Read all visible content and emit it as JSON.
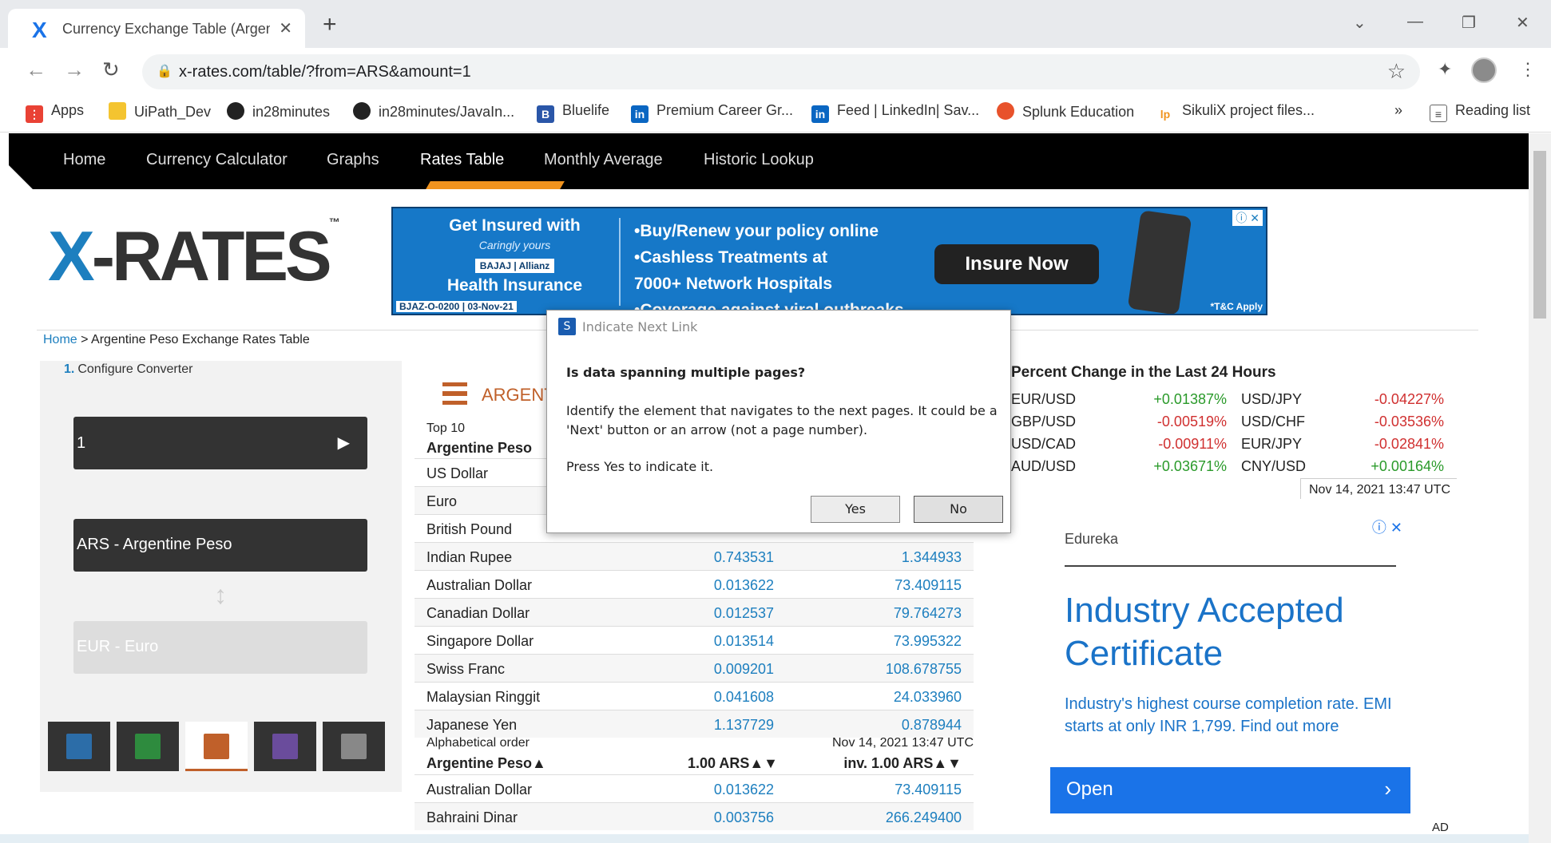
{
  "browser": {
    "tab_title": "Currency Exchange Table (Argent",
    "tab_favicon": "X",
    "url": "x-rates.com/table/?from=ARS&amount=1",
    "bookmarks": [
      {
        "label": "Apps",
        "icon": "apps-icon"
      },
      {
        "label": "UiPath_Dev",
        "icon": "folder-icon"
      },
      {
        "label": "in28minutes",
        "icon": "github-icon"
      },
      {
        "label": "in28minutes/JavaIn...",
        "icon": "github-icon"
      },
      {
        "label": "Bluelife",
        "icon": "bluelife-icon"
      },
      {
        "label": "Premium Career Gr...",
        "icon": "linkedin-icon"
      },
      {
        "label": "Feed | LinkedIn| Sav...",
        "icon": "linkedin-icon"
      },
      {
        "label": "Splunk Education",
        "icon": "splunk-icon"
      },
      {
        "label": "SikuliX project files...",
        "icon": "launchpad-icon"
      }
    ],
    "more_bookmarks": "»",
    "reading_list": "Reading list"
  },
  "site": {
    "nav": [
      "Home",
      "Currency Calculator",
      "Graphs",
      "Rates Table",
      "Monthly Average",
      "Historic Lookup"
    ],
    "active_nav": "Rates Table",
    "logo": {
      "x": "X",
      "rest": "-RATES",
      "tm": "™"
    },
    "banner": {
      "line1": "Get Insured with",
      "tagline": "Caringly yours",
      "brand": "BAJAJ | Allianz",
      "line2": "Health Insurance",
      "bullets": [
        "•Buy/Renew your policy online",
        "•Cashless Treatments at",
        " 7000+ Network Hospitals",
        "•Coverage against viral outbreaks"
      ],
      "cta": "Insure Now",
      "code": "BJAZ-O-0200 | 03-Nov-21",
      "tc": "*T&C Apply",
      "ad_info": "ⓘ ✕"
    },
    "breadcrumb": {
      "home": "Home",
      "current": "> Argentine Peso Exchange Rates Table"
    }
  },
  "converter": {
    "step_number": "1.",
    "step_label": "Configure Converter",
    "amount": "1",
    "from": "ARS - Argentine Peso",
    "swap": "↕",
    "to": "EUR - Euro"
  },
  "rates": {
    "heading": "ARGENT",
    "top10": "Top 10",
    "base": "Argentine Peso",
    "rows": [
      {
        "name": "US Dollar",
        "v1": "",
        "v2": ""
      },
      {
        "name": "Euro",
        "v1": "",
        "v2": ""
      },
      {
        "name": "British Pound",
        "v1": "",
        "v2": ""
      },
      {
        "name": "Indian Rupee",
        "v1": "0.743531",
        "v2": "1.344933"
      },
      {
        "name": "Australian Dollar",
        "v1": "0.013622",
        "v2": "73.409115"
      },
      {
        "name": "Canadian Dollar",
        "v1": "0.012537",
        "v2": "79.764273"
      },
      {
        "name": "Singapore Dollar",
        "v1": "0.013514",
        "v2": "73.995322"
      },
      {
        "name": "Swiss Franc",
        "v1": "0.009201",
        "v2": "108.678755"
      },
      {
        "name": "Malaysian Ringgit",
        "v1": "0.041608",
        "v2": "24.033960"
      },
      {
        "name": "Japanese Yen",
        "v1": "1.137729",
        "v2": "0.878944"
      }
    ],
    "alpha_label": "Alphabetical order",
    "alpha_date": "Nov 14, 2021 13:47 UTC",
    "alpha_h1": "Argentine Peso▲",
    "alpha_h2": "1.00 ARS▲▼",
    "alpha_h3": "inv. 1.00 ARS▲▼",
    "alpha_rows": [
      {
        "name": "Australian Dollar",
        "v1": "0.013622",
        "v2": "73.409115"
      },
      {
        "name": "Bahraini Dinar",
        "v1": "0.003756",
        "v2": "266.249400"
      }
    ]
  },
  "percent_change": {
    "title": "Percent Change in the Last 24 Hours",
    "rows": [
      {
        "p1": "EUR/USD",
        "c1": "+0.01387%",
        "p2": "USD/JPY",
        "c2": "-0.04227%"
      },
      {
        "p1": "GBP/USD",
        "c1": "-0.00519%",
        "p2": "USD/CHF",
        "c2": "-0.03536%"
      },
      {
        "p1": "USD/CAD",
        "c1": "-0.00911%",
        "p2": "EUR/JPY",
        "c2": "-0.02841%"
      },
      {
        "p1": "AUD/USD",
        "c1": "+0.03671%",
        "p2": "CNY/USD",
        "c2": "+0.00164%"
      }
    ],
    "timestamp": "Nov 14, 2021 13:47 UTC"
  },
  "side_ad": {
    "advertiser": "Edureka",
    "headline": "Industry Accepted Certificate",
    "body": "Industry's highest course completion rate. EMI starts at only INR 1,799. Find out more",
    "open": "Open",
    "chevron": "›",
    "ad_info": "ⓘ ✕",
    "ad_label": "AD"
  },
  "dialog": {
    "title": "Indicate Next Link",
    "icon": "S",
    "question": "Is data spanning multiple pages?",
    "message": "Identify the element that navigates to the next pages. It could be a 'Next' button or an arrow (not a page number).",
    "instruction": "Press Yes to indicate it.",
    "yes": "Yes",
    "no": "No"
  },
  "colors": {
    "accent": "#f0931e",
    "link": "#1d7fbf",
    "positive": "#2a9a2a",
    "negative": "#d03030"
  }
}
